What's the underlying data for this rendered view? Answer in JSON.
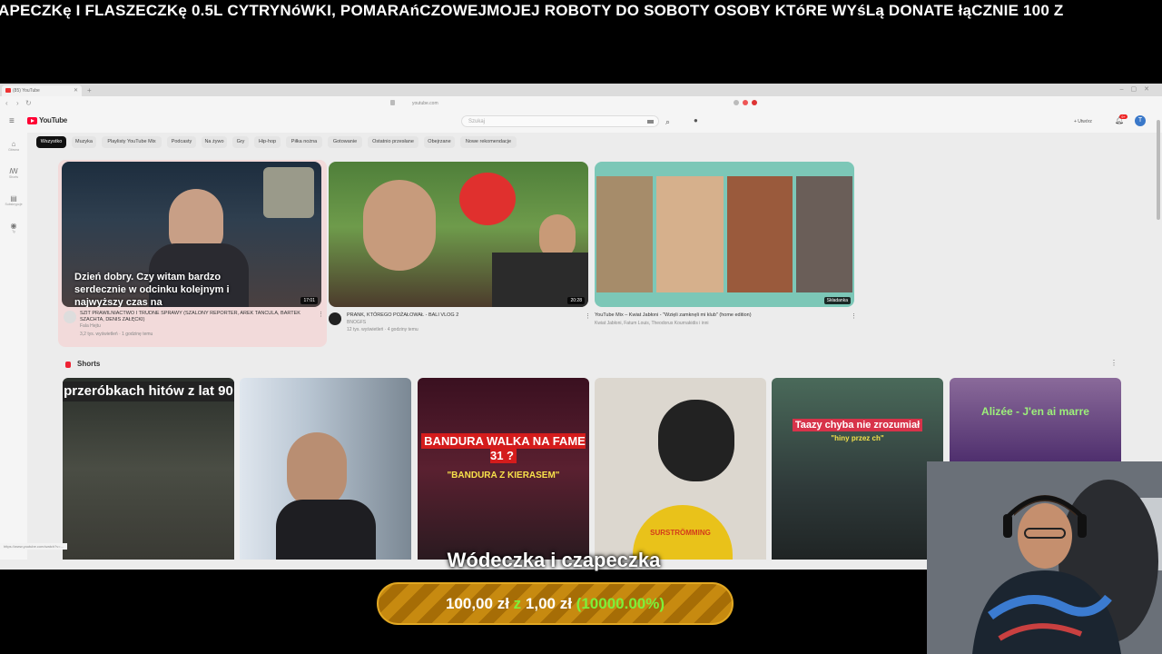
{
  "ticker": {
    "text": "APECZKę I FLASZECZKę 0.5L CYTRYNóWKI, POMARAńCZOWEJMOJEJ ROBOTY DO SOBOTY OSOBY KTóRE WYśLą DONATE łąCZNIE 100 Z"
  },
  "browser": {
    "tab_title": "(85) YouTube",
    "url": "youtube.com",
    "status_url": "https://www.youtube.com/watch?v=..."
  },
  "youtube": {
    "logo": "YouTube",
    "search_placeholder": "Szukaj",
    "create_label": "+ Utwórz",
    "notif_count": "9+",
    "avatar_letter": "T",
    "sidebar": [
      {
        "label": "Główna",
        "icon": "home-icon"
      },
      {
        "label": "Shorts",
        "icon": "shorts-icon"
      },
      {
        "label": "Subskrypcje",
        "icon": "subscriptions-icon"
      },
      {
        "label": "Ty",
        "icon": "you-icon"
      }
    ],
    "chips": [
      "Wszystko",
      "Muzyka",
      "Playlisty YouTube Mix",
      "Podcasty",
      "Na żywo",
      "Gry",
      "Hip-hop",
      "Piłka nożna",
      "Gotowanie",
      "Ostatnio przesłane",
      "Obejrzane",
      "Nowe rekomendacje"
    ],
    "videos": [
      {
        "title": "SZIT PRAWILNIACTWO I TRUDNE SPRAWY (SZALONY REPORTER, AREK TANCULA, BARTEK SZACHTA, DENIS ZAŁĘCKI)",
        "channel": "Fala Hejtu",
        "meta": "3,2 tys. wyświetleń · 1 godzinę temu",
        "duration": "17:01",
        "caption": "Dzień dobry. Czy witam bardzo serdecznie w odcinku kolejnym i najwyższy czas na"
      },
      {
        "title": "PRANK, KTÓREGO POŻAŁOWAŁ - BALI VLOG 2",
        "channel": "BNOGFS",
        "meta": "12 tys. wyświetleń · 4 godziny temu",
        "duration": "20:28"
      },
      {
        "title": "YouTube Mix – Kwiat Jabłoni - \"Wzięli zamknęli mi klub\" (home edition)",
        "channel": "Kwiat Jabłoni, Fatum Louis, Theodorus Kournakidis i inni",
        "meta": "",
        "duration": "Składanka"
      }
    ],
    "shorts_label": "Shorts",
    "shorts": [
      {
        "caption": "przeróbkach hitów z lat 90"
      },
      {
        "caption": ""
      },
      {
        "caption": "BANDURA WALKA NA FAME 31 ?",
        "sub": "\"BANDURA Z KIERASEM\""
      },
      {
        "caption": "",
        "sub": "SURSTRÖMMING"
      },
      {
        "caption": "Taazy chyba nie zrozumiał",
        "sub": "\"hiny przez ch\""
      },
      {
        "caption": "Alizée - J'en ai marre"
      }
    ]
  },
  "overlay": {
    "donation_title": "Wódeczka i czapeczka",
    "amount_current": "100,00 zł",
    "separator": "z",
    "amount_goal": "1,00 zł",
    "percent": "(10000.00%)"
  },
  "colors": {
    "accent_red": "#ff0033",
    "goal_green": "#7df03a",
    "pill_gold": "#c78a10"
  }
}
